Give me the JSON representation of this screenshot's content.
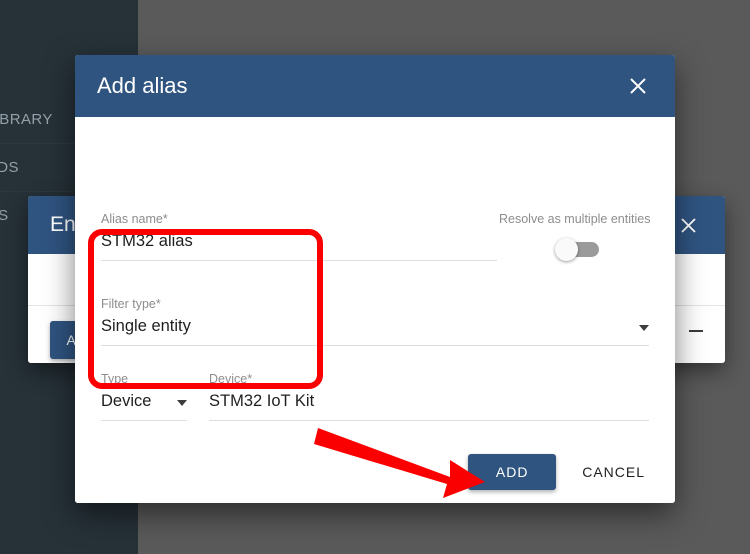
{
  "background": {
    "scrim_color": "#5a5a5a",
    "sidebar": {
      "items": [
        {
          "label": "LIBRARY"
        },
        {
          "label": "RDS"
        },
        {
          "label": "GS"
        }
      ]
    },
    "underlying_dialog": {
      "title": "Enti",
      "close_icon": "close-icon",
      "add_label": "AD",
      "collapse_icon": "minus-icon"
    }
  },
  "dialog": {
    "title": "Add alias",
    "close_icon": "close-icon",
    "header_color": "#2f5480",
    "fields": {
      "alias_name": {
        "label": "Alias name",
        "required_marker": "*",
        "value": "STM32 alias"
      },
      "resolve_multiple": {
        "label": "Resolve as multiple entities",
        "state": "off"
      },
      "filter_type": {
        "label": "Filter type",
        "required_marker": "*",
        "value": "Single entity",
        "dropdown_icon": "chevron-down-icon"
      },
      "type": {
        "label": "Type",
        "required_marker": "",
        "value": "Device",
        "dropdown_icon": "chevron-down-icon"
      },
      "device": {
        "label": "Device",
        "required_marker": "*",
        "value": "STM32 IoT Kit"
      }
    },
    "footer": {
      "add_label": "ADD",
      "cancel_label": "CANCEL"
    }
  },
  "annotations": {
    "highlight_color": "#fb0000",
    "highlight_target": "filter-type-and-device-group",
    "arrow_color": "#fb0000",
    "arrow_target": "add-button"
  }
}
